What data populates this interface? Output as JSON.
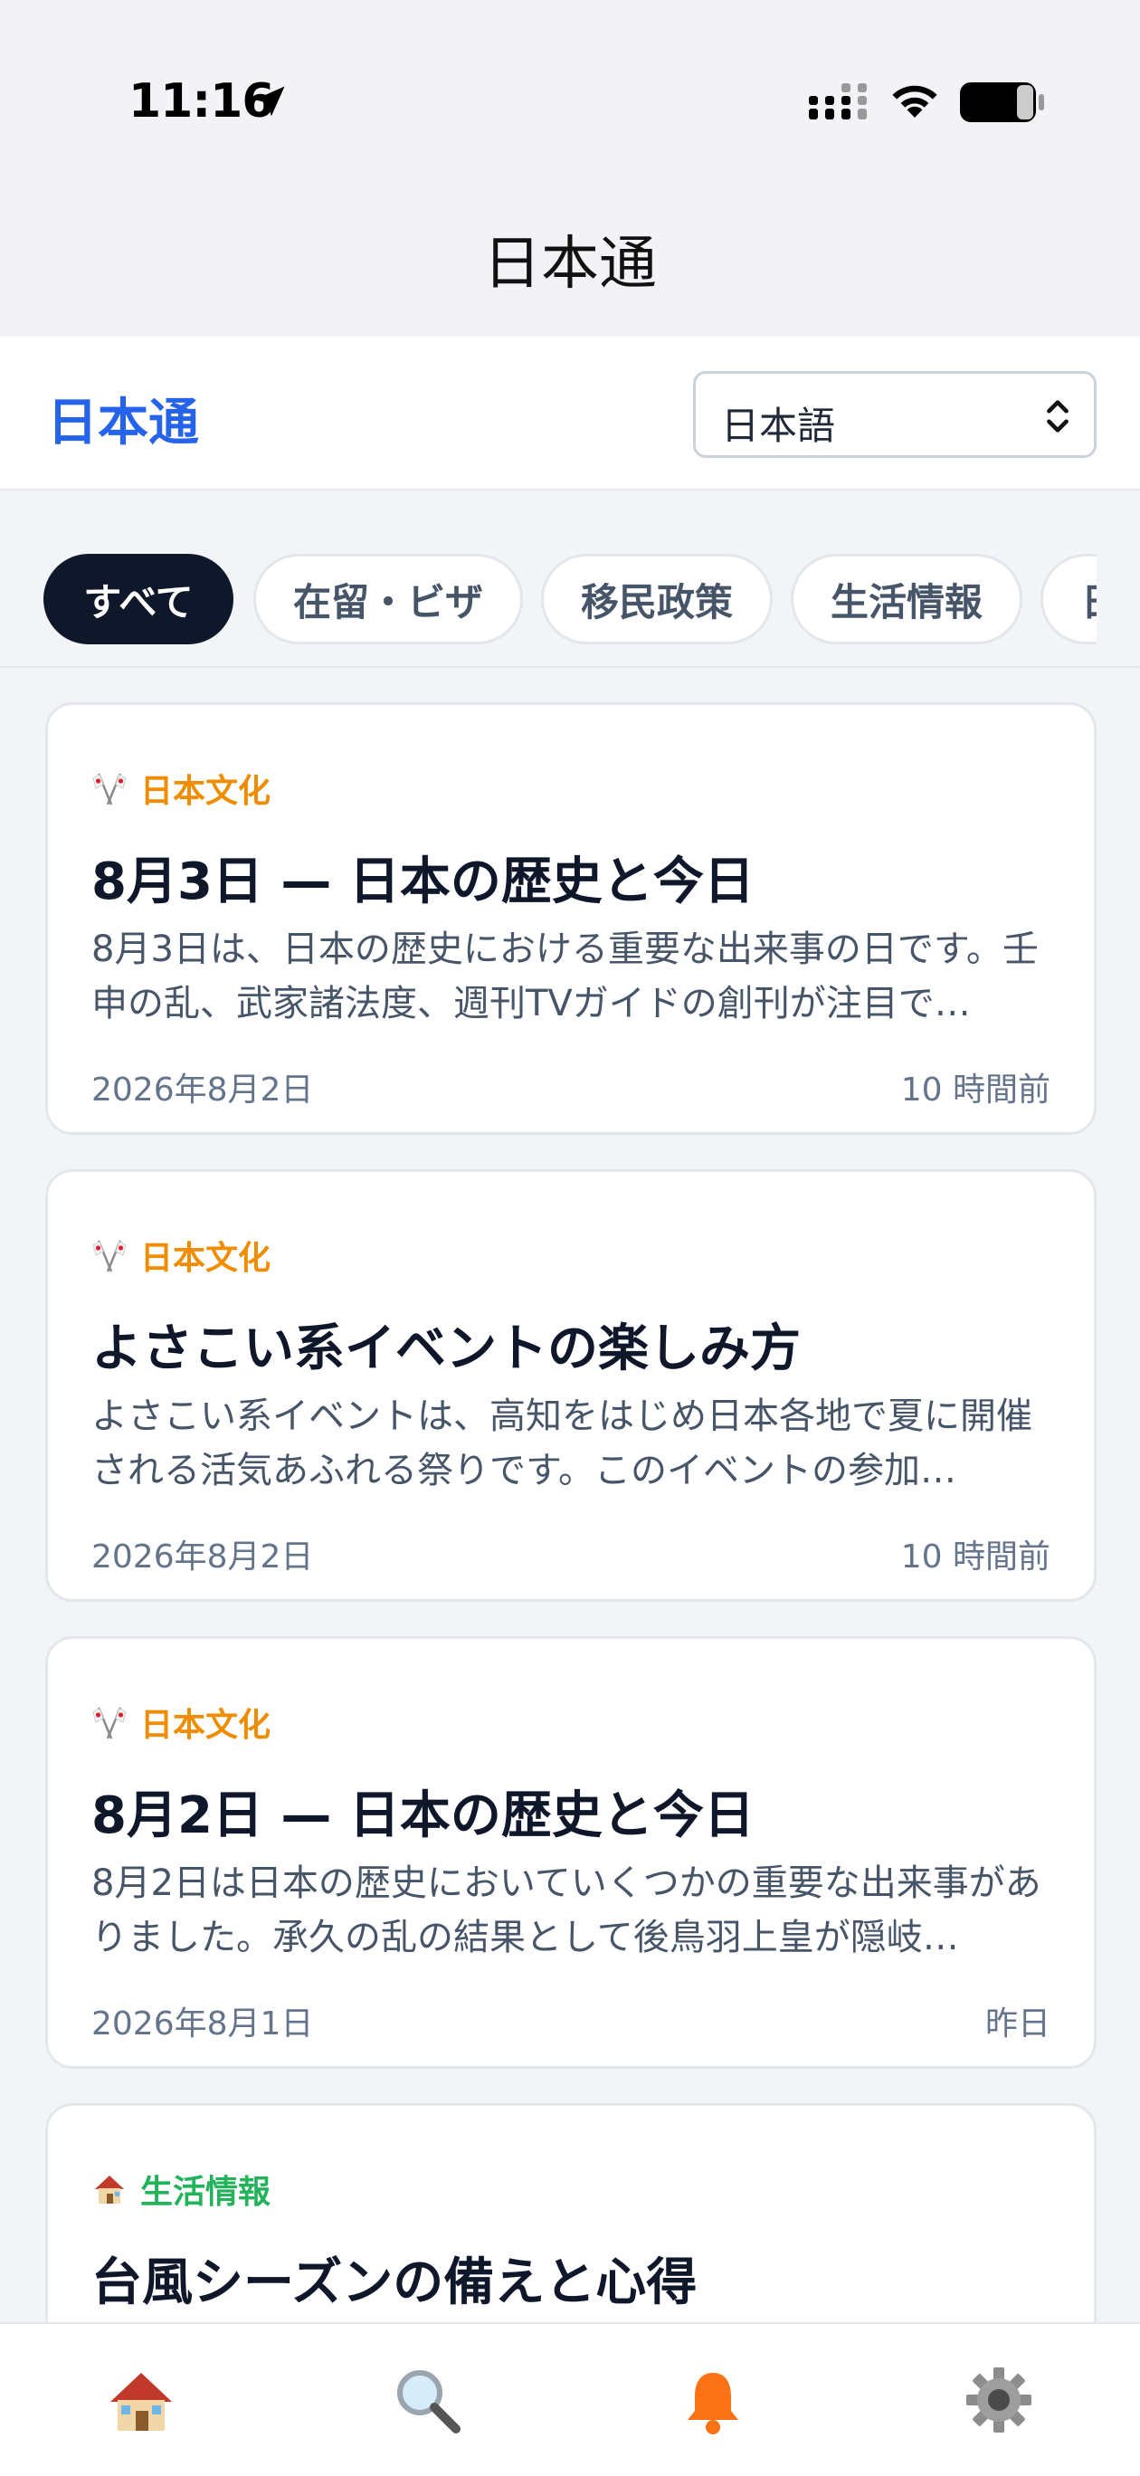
{
  "status_bar": {
    "time": "11:16",
    "icons": [
      "location-arrow-icon",
      "cellular-signal-icon",
      "wifi-icon",
      "battery-icon"
    ]
  },
  "app_title": "日本通",
  "header": {
    "brand": "日本通",
    "language_select": {
      "value": "日本語"
    },
    "colors": {
      "brand": "#2563eb"
    }
  },
  "categories": [
    {
      "label": "すべて",
      "active": true
    },
    {
      "label": "在留・ビザ",
      "active": false
    },
    {
      "label": "移民政策",
      "active": false
    },
    {
      "label": "生活情報",
      "active": false
    },
    {
      "label": "日",
      "active": false
    }
  ],
  "articles": [
    {
      "category_icon": "crossed-flags-icon",
      "category": "日本文化",
      "title": "8月3日 — 日本の歴史と今日",
      "excerpt": "8月3日は、日本の歴史における重要な出来事の日です。壬申の乱、武家諸法度、週刊TVガイドの創刊が注目で…",
      "date": "2026年8月2日",
      "age": "10 時間前"
    },
    {
      "category_icon": "crossed-flags-icon",
      "category": "日本文化",
      "title": "よさこい系イベントの楽しみ方",
      "excerpt": "よさこい系イベントは、高知をはじめ日本各地で夏に開催される活気あふれる祭りです。このイベントの参加…",
      "date": "2026年8月2日",
      "age": "10 時間前"
    },
    {
      "category_icon": "crossed-flags-icon",
      "category": "日本文化",
      "title": "8月2日 — 日本の歴史と今日",
      "excerpt": "8月2日は日本の歴史においていくつかの重要な出来事がありました。承久の乱の結果として後鳥羽上皇が隠岐…",
      "date": "2026年8月1日",
      "age": "昨日"
    },
    {
      "category_icon": "house-icon",
      "category": "生活情報",
      "title": "台風シーズンの備えと心得"
    }
  ],
  "tabbar": {
    "tabs": [
      {
        "icon": "house-icon",
        "active": false
      },
      {
        "icon": "search-icon",
        "active": false
      },
      {
        "icon": "bell-icon",
        "active": true
      },
      {
        "icon": "gear-icon",
        "active": false
      }
    ],
    "colors": {
      "active": "#f97316"
    }
  }
}
